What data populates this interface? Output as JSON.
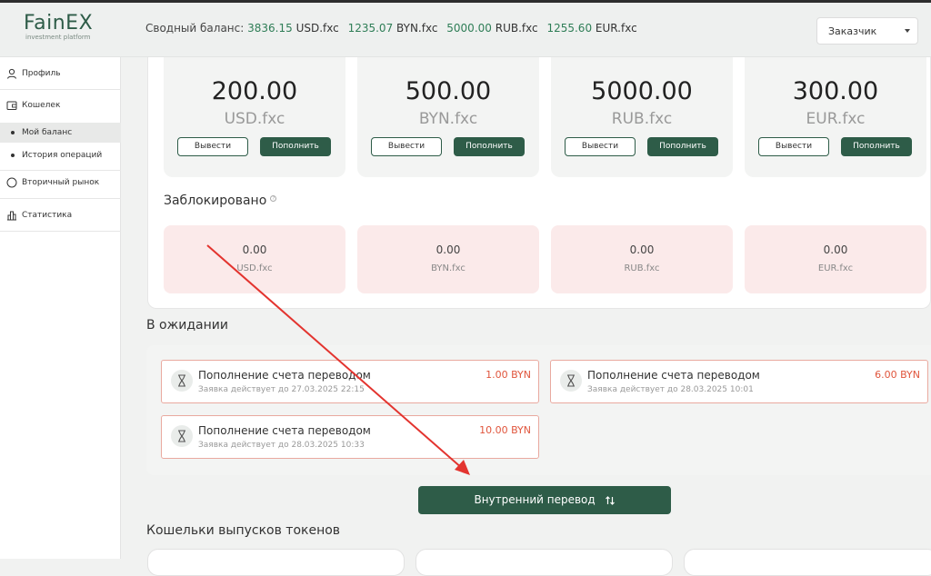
{
  "header": {
    "logo_name": "FainEX",
    "logo_sub": "investment platform",
    "summary_label": "Сводный баланс:",
    "summary": [
      {
        "value": "3836.15",
        "currency": "USD.fxc"
      },
      {
        "value": "1235.07",
        "currency": "BYN.fxc"
      },
      {
        "value": "5000.00",
        "currency": "RUB.fxc"
      },
      {
        "value": "1255.60",
        "currency": "EUR.fxc"
      }
    ],
    "role": "Заказчик"
  },
  "sidebar": {
    "profile": "Профиль",
    "wallet": "Кошелек",
    "my_balance": "Мой баланс",
    "history": "История операций",
    "secondary_market": "Вторичный рынок",
    "statistics": "Статистика"
  },
  "balances": [
    {
      "amount": "200.00",
      "currency": "USD.fxc",
      "withdraw": "Вывести",
      "topup": "Пополнить"
    },
    {
      "amount": "500.00",
      "currency": "BYN.fxc",
      "withdraw": "Вывести",
      "topup": "Пополнить"
    },
    {
      "amount": "5000.00",
      "currency": "RUB.fxc",
      "withdraw": "Вывести",
      "topup": "Пополнить"
    },
    {
      "amount": "300.00",
      "currency": "EUR.fxc",
      "withdraw": "Вывести",
      "topup": "Пополнить"
    }
  ],
  "blocked": {
    "title": "Заблокировано",
    "info": "?",
    "items": [
      {
        "amount": "0.00",
        "currency": "USD.fxc"
      },
      {
        "amount": "0.00",
        "currency": "BYN.fxc"
      },
      {
        "amount": "0.00",
        "currency": "RUB.fxc"
      },
      {
        "amount": "0.00",
        "currency": "EUR.fxc"
      }
    ]
  },
  "pending": {
    "title": "В ожидании",
    "items": [
      {
        "title": "Пополнение счета переводом",
        "sub": "Заявка действует до 27.03.2025 22:15",
        "amount": "1.00 BYN"
      },
      {
        "title": "Пополнение счета переводом",
        "sub": "Заявка действует до 28.03.2025 10:01",
        "amount": "6.00 BYN"
      },
      {
        "title": "Пополнение счета переводом",
        "sub": "Заявка действует до 28.03.2025 10:33",
        "amount": "10.00 BYN"
      }
    ]
  },
  "transfer_button": "Внутренний перевод",
  "wallets_title": "Кошельки выпусков токенов",
  "colors": {
    "accent": "#2e5c48",
    "pending_border": "#e9a99f",
    "pending_amount": "#e0553c",
    "blocked_bg": "#fbeaea",
    "annotation_arrow": "#e3342f"
  }
}
